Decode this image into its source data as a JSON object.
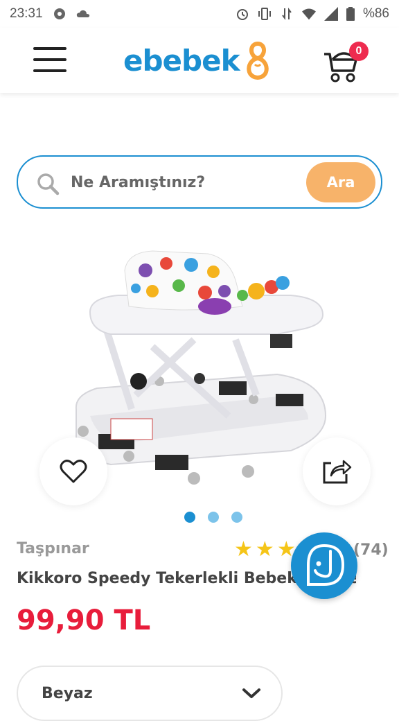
{
  "status_bar": {
    "time": "23:31",
    "battery": "%86",
    "icons": [
      "notification-icon",
      "cloud-icon",
      "alarm-icon",
      "vibrate-icon",
      "data-icon",
      "wifi-icon",
      "signal-icon",
      "battery-icon"
    ]
  },
  "header": {
    "logo_text": "ebebek",
    "cart_count": "0",
    "brand_color": "#1b8fd1",
    "accent_color": "#f7a33a"
  },
  "search": {
    "placeholder": "Ne Aramıştınız?",
    "button_label": "Ara"
  },
  "product": {
    "brand": "Taşpınar",
    "title": "Kikkoro Speedy Tekerlekli Bebek Yürüteci",
    "price": "99,90 TL",
    "rating": 5,
    "review_count": "(74)",
    "carousel": {
      "total": 3,
      "active": 1
    },
    "variant": {
      "selected": "Beyaz"
    }
  },
  "colors": {
    "price": "#e81d3b",
    "star": "#f5c518",
    "dot_active": "#1b8fd1",
    "dot_inactive": "#7cc3ea"
  }
}
